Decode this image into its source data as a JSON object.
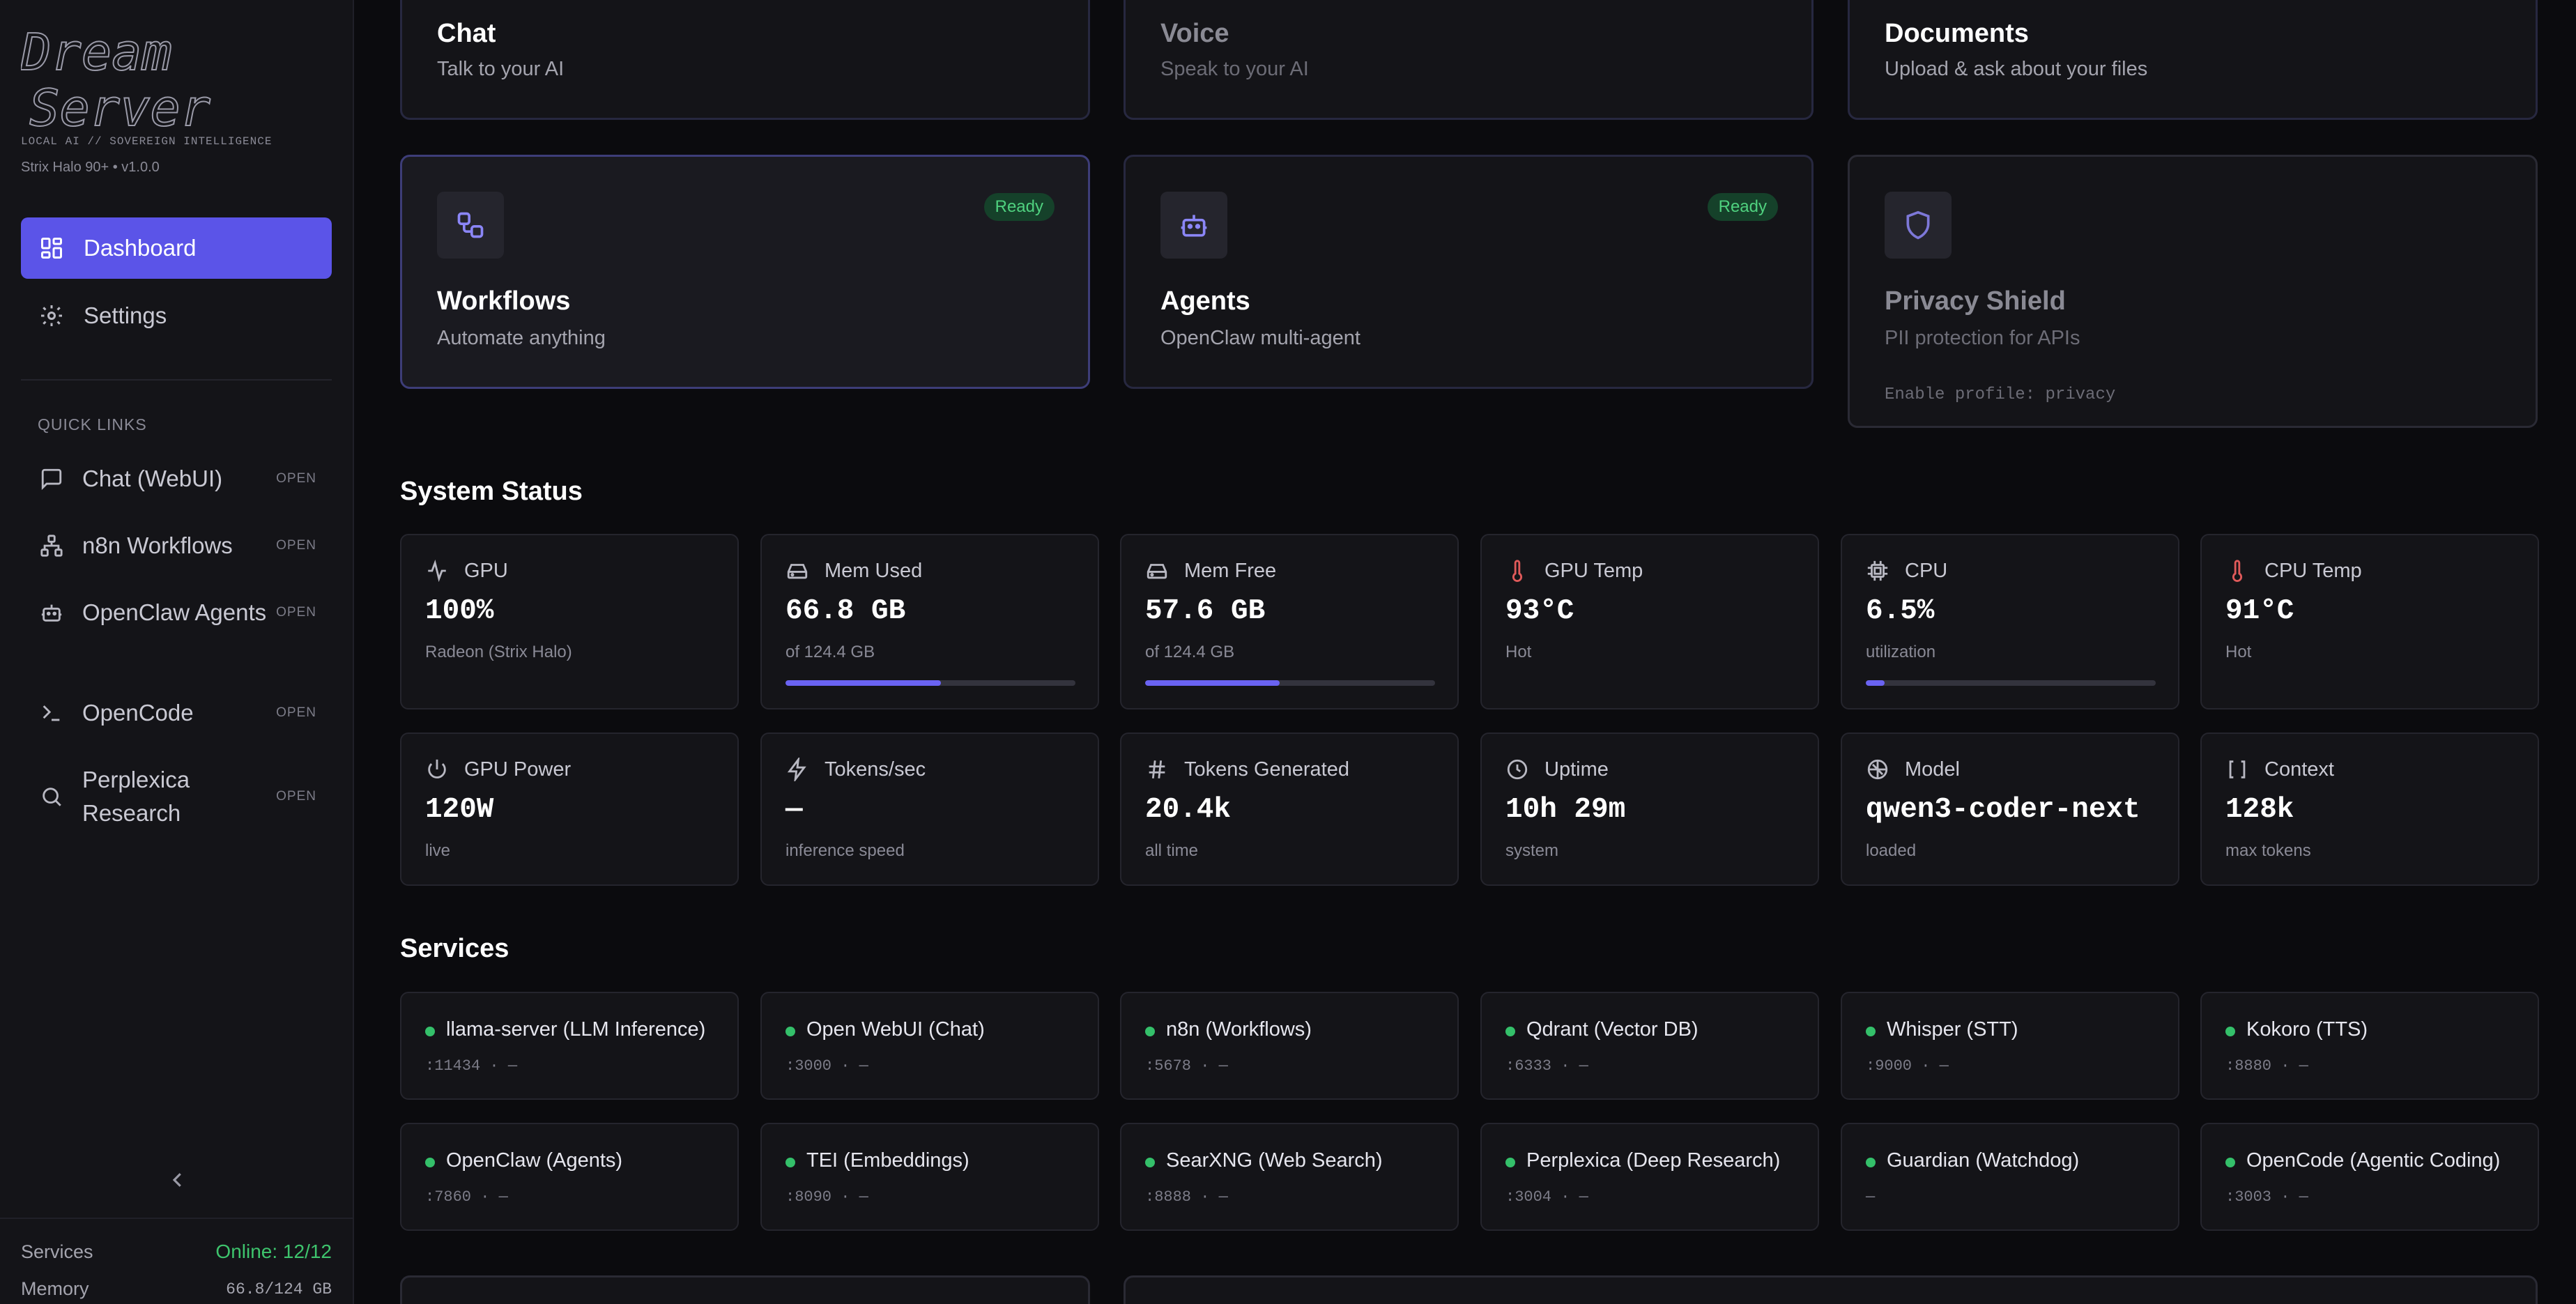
{
  "sidebar": {
    "logo_text": "Dream Server",
    "tagline": "LOCAL AI // SOVEREIGN INTELLIGENCE",
    "version": "Strix Halo 90+ • v1.0.0",
    "nav": [
      {
        "label": "Dashboard",
        "icon": "dashboard-icon",
        "active": true
      },
      {
        "label": "Settings",
        "icon": "gear-icon",
        "active": false
      }
    ],
    "quick_links_label": "QUICK LINKS",
    "quick_links": [
      {
        "label": "Chat (WebUI)",
        "badge": "OPEN",
        "icon": "chat-icon"
      },
      {
        "label": "n8n Workflows",
        "badge": "OPEN",
        "icon": "workflow-icon"
      },
      {
        "label": "OpenClaw Agents",
        "badge": "OPEN",
        "icon": "bot-icon"
      },
      {
        "label": "OpenCode",
        "badge": "OPEN",
        "icon": "terminal-icon"
      },
      {
        "label": "Perplexica Research",
        "badge": "OPEN",
        "icon": "search-icon"
      }
    ],
    "footer": {
      "services_label": "Services",
      "services_value": "Online: 12/12",
      "memory_label": "Memory",
      "memory_value": "66.8/124 GB"
    }
  },
  "feature_cards": [
    {
      "title": "Chat",
      "subtitle": "Talk to your AI"
    },
    {
      "title": "Voice",
      "subtitle": "Speak to your AI"
    },
    {
      "title": "Documents",
      "subtitle": "Upload & ask about your files"
    },
    {
      "title": "Workflows",
      "subtitle": "Automate anything",
      "badge": "Ready",
      "icon": "workflow-icon"
    },
    {
      "title": "Agents",
      "subtitle": "OpenClaw multi-agent",
      "badge": "Ready",
      "icon": "bot-icon"
    },
    {
      "title": "Privacy Shield",
      "subtitle": "PII protection for APIs",
      "note": "Enable profile: privacy",
      "icon": "shield-icon"
    }
  ],
  "system_status": {
    "title": "System Status",
    "metrics": [
      {
        "label": "GPU",
        "value": "100%",
        "sub": "Radeon (Strix Halo)",
        "icon": "activity-icon"
      },
      {
        "label": "Mem Used",
        "value": "66.8 GB",
        "sub": "of 124.4 GB",
        "icon": "drive-icon",
        "bar": 0.537
      },
      {
        "label": "Mem Free",
        "value": "57.6 GB",
        "sub": "of 124.4 GB",
        "icon": "drive-icon",
        "bar": 0.463
      },
      {
        "label": "GPU Temp",
        "value": "93°C",
        "sub": "Hot",
        "icon": "thermometer-icon"
      },
      {
        "label": "CPU",
        "value": "6.5%",
        "sub": "utilization",
        "icon": "cpu-icon",
        "bar": 0.065
      },
      {
        "label": "CPU Temp",
        "value": "91°C",
        "sub": "Hot",
        "icon": "thermometer-icon"
      },
      {
        "label": "GPU Power",
        "value": "120W",
        "sub": "live",
        "icon": "power-icon"
      },
      {
        "label": "Tokens/sec",
        "value": "—",
        "sub": "inference speed",
        "icon": "bolt-icon"
      },
      {
        "label": "Tokens Generated",
        "value": "20.4k",
        "sub": "all time",
        "icon": "hash-icon"
      },
      {
        "label": "Uptime",
        "value": "10h 29m",
        "sub": "system",
        "icon": "clock-icon"
      },
      {
        "label": "Model",
        "value": "qwen3-coder-next",
        "sub": "loaded",
        "icon": "brain-icon"
      },
      {
        "label": "Context",
        "value": "128k",
        "sub": "max tokens",
        "icon": "brackets-icon"
      }
    ]
  },
  "services": {
    "title": "Services",
    "items": [
      {
        "name": "llama-server (LLM Inference)",
        "port": ":11434 · —"
      },
      {
        "name": "Open WebUI (Chat)",
        "port": ":3000 · —"
      },
      {
        "name": "n8n (Workflows)",
        "port": ":5678 · —"
      },
      {
        "name": "Qdrant (Vector DB)",
        "port": ":6333 · —"
      },
      {
        "name": "Whisper (STT)",
        "port": ":9000 · —"
      },
      {
        "name": "Kokoro (TTS)",
        "port": ":8880 · —"
      },
      {
        "name": "OpenClaw (Agents)",
        "port": ":7860 · —"
      },
      {
        "name": "TEI (Embeddings)",
        "port": ":8090 · —"
      },
      {
        "name": "SearXNG (Web Search)",
        "port": ":8888 · —"
      },
      {
        "name": "Perplexica (Deep Research)",
        "port": ":3004 · —"
      },
      {
        "name": "Guardian (Watchdog)",
        "port": "—"
      },
      {
        "name": "OpenCode (Agentic Coding)",
        "port": ":3003 · —"
      }
    ]
  },
  "colors": {
    "accent": "#5b54e8",
    "online": "#34c06a",
    "hot": "#e05a5a",
    "background": "#0b0b0e"
  }
}
